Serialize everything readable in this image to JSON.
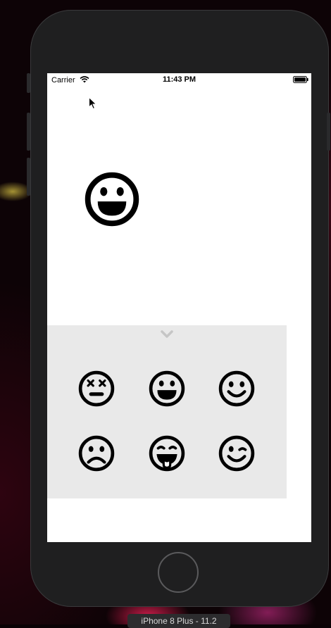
{
  "status_bar": {
    "carrier": "Carrier",
    "time": "11:43 PM",
    "wifi_icon": "wifi-icon",
    "battery_icon": "battery-full-icon"
  },
  "selected_emoji": {
    "icon": "grinning-face-icon"
  },
  "drawer": {
    "toggle_icon": "chevron-down-icon",
    "background_color": "#e9e9e9",
    "emojis": [
      "dizzy-face-icon",
      "grinning-face-icon",
      "smiling-face-icon",
      "frowning-face-icon",
      "tongue-out-face-icon",
      "winking-face-icon"
    ]
  },
  "simulator": {
    "device_label": "iPhone 8 Plus - 11.2"
  },
  "colors": {
    "screen_background": "#ffffff",
    "emoji_stroke": "#000000",
    "chevron": "#c6c6c6",
    "phone_body": "#1f1f20"
  }
}
